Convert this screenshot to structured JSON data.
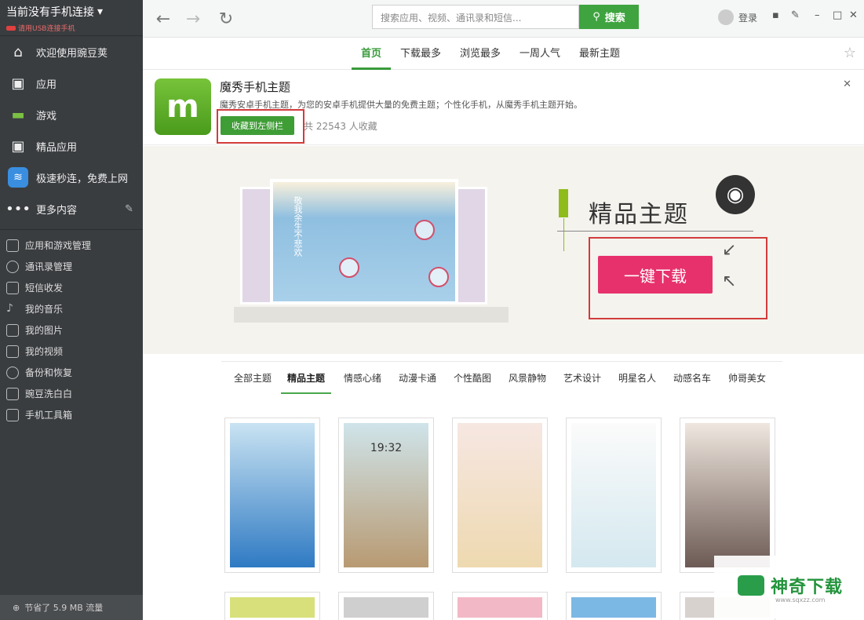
{
  "sidebar": {
    "connection_title": "当前没有手机连接",
    "connection_sub": "请用USB连接手机",
    "main_items": [
      {
        "label": "欢迎使用豌豆荚",
        "icon": "home-icon"
      },
      {
        "label": "应用",
        "icon": "briefcase-icon"
      },
      {
        "label": "游戏",
        "icon": "gamepad-icon"
      },
      {
        "label": "精品应用",
        "icon": "briefcase-icon"
      },
      {
        "label": "极速秒连，免费上网",
        "icon": "wifi-icon"
      },
      {
        "label": "更多内容",
        "icon": "more-icon"
      }
    ],
    "sub_items": [
      {
        "label": "应用和游戏管理",
        "icon": "cube-icon"
      },
      {
        "label": "通讯录管理",
        "icon": "person-icon"
      },
      {
        "label": "短信收发",
        "icon": "message-icon"
      },
      {
        "label": "我的音乐",
        "icon": "music-icon"
      },
      {
        "label": "我的图片",
        "icon": "image-icon"
      },
      {
        "label": "我的视频",
        "icon": "video-icon"
      },
      {
        "label": "备份和恢复",
        "icon": "backup-icon"
      },
      {
        "label": "豌豆洗白白",
        "icon": "clean-icon"
      },
      {
        "label": "手机工具箱",
        "icon": "toolbox-icon"
      }
    ],
    "footer": "节省了 5.9 MB 流量"
  },
  "toolbar": {
    "search_placeholder": "搜索应用、视频、通讯录和短信...",
    "search_button": "搜索",
    "login": "登录"
  },
  "tabs": [
    "首页",
    "下载最多",
    "浏览最多",
    "一周人气",
    "最新主题"
  ],
  "app": {
    "title": "魔秀手机主题",
    "description": "魔秀安卓手机主题，为您的安卓手机提供大量的免费主题；个性化手机，从魔秀手机主题开始。",
    "collect_button": "收藏到左侧栏",
    "count": "共 22543 人收藏"
  },
  "banner": {
    "title": "精品主题",
    "download_button": "一键下载",
    "photo_text": "敬我余生不悲欢"
  },
  "categories": [
    "全部主题",
    "精品主题",
    "情感心绪",
    "动漫卡通",
    "个性酷图",
    "风景静物",
    "艺术设计",
    "明星名人",
    "动感名车",
    "帅哥美女"
  ],
  "active_category": "精品主题",
  "theme_thumbs": [
    {
      "time": "",
      "colors": [
        "#c9e3f2",
        "#2f7ac3"
      ]
    },
    {
      "time": "19:32",
      "colors": [
        "#cfe4ea",
        "#b89a72"
      ]
    },
    {
      "time": "",
      "colors": [
        "#f6e7e2",
        "#eed9b0"
      ]
    },
    {
      "time": "",
      "colors": [
        "#fbfbfb",
        "#d4e8ef"
      ]
    },
    {
      "time": "",
      "colors": [
        "#efe7df",
        "#6c5a54"
      ]
    }
  ],
  "watermark": {
    "text": "神奇下载",
    "url": "www.sqxzz.com"
  }
}
